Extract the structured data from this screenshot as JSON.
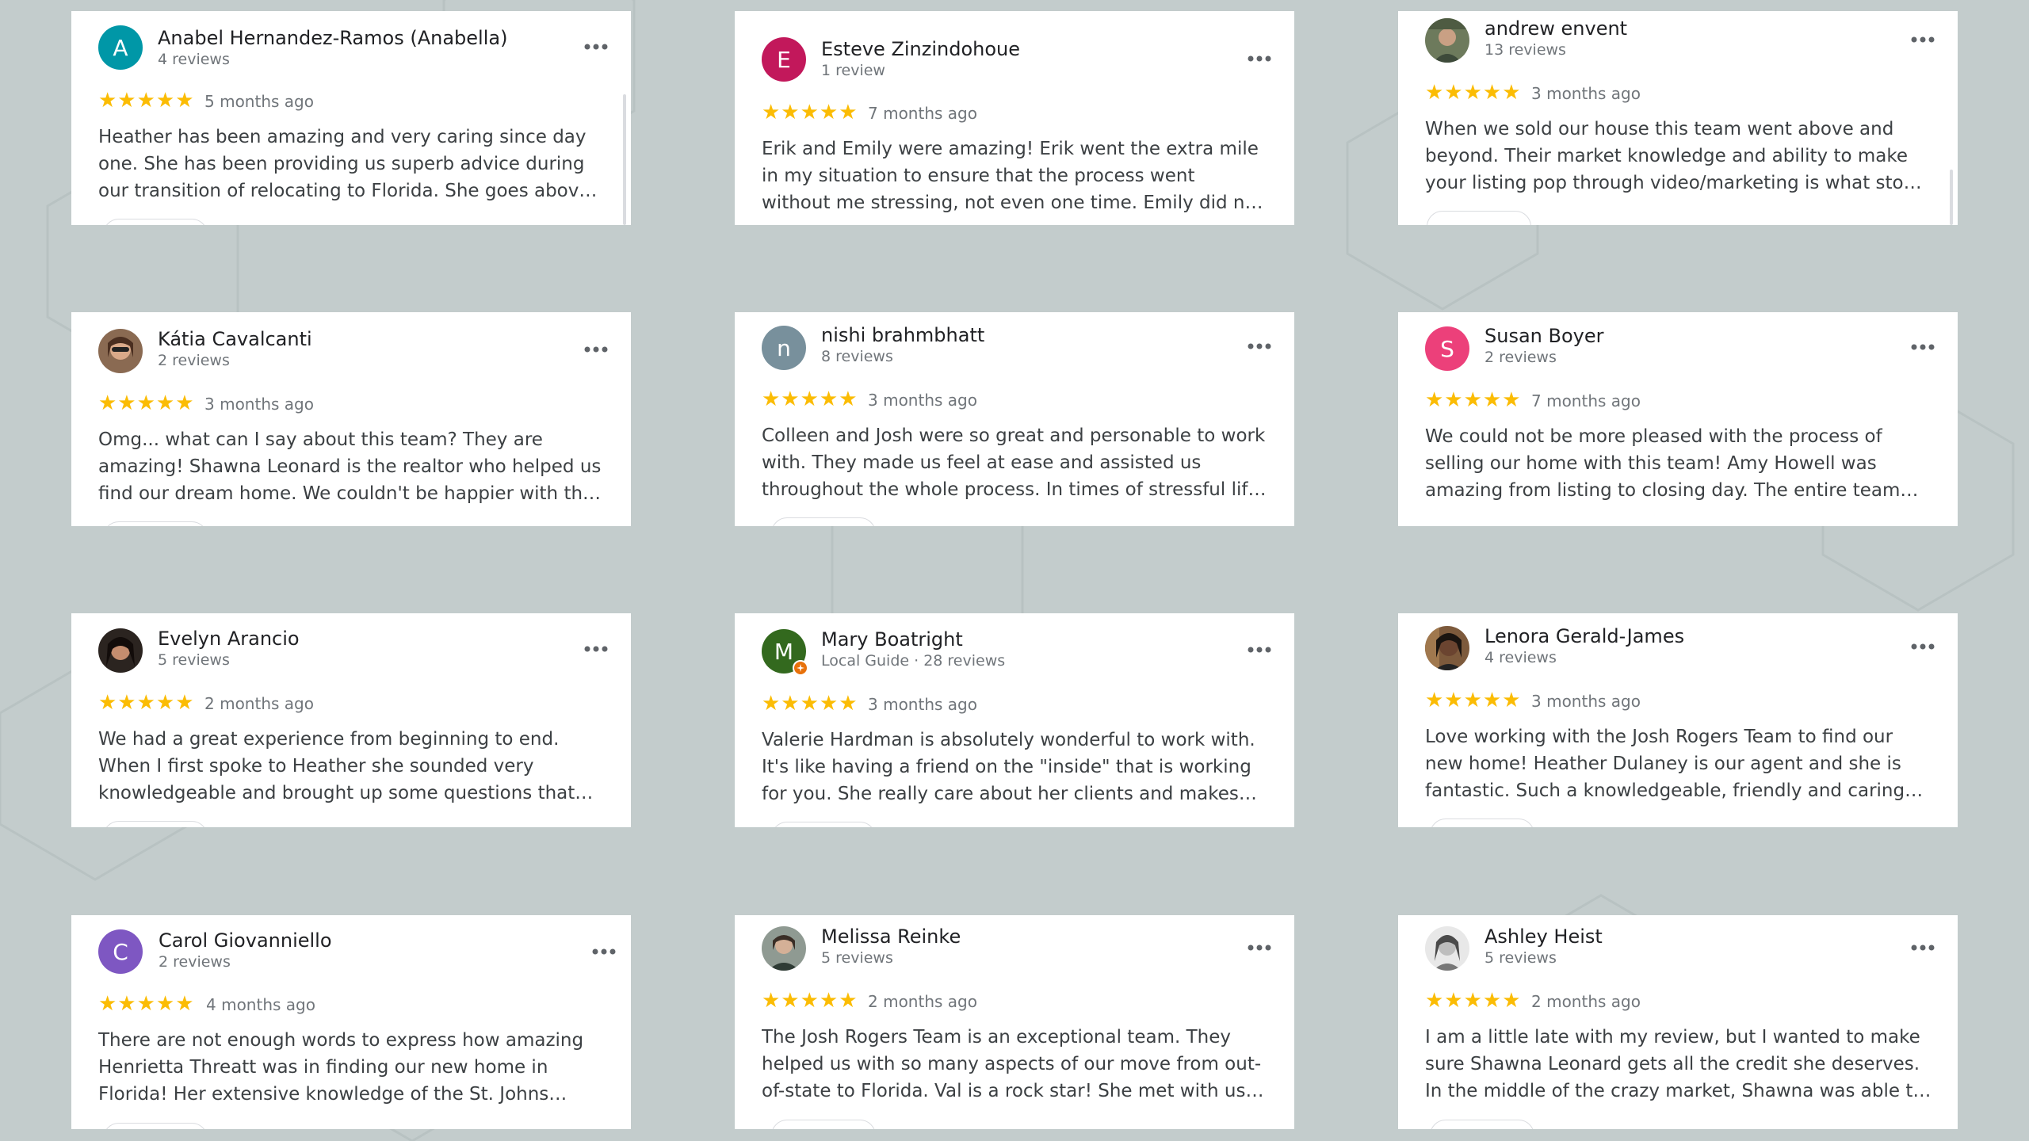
{
  "colors": {
    "background": "#c3cccc",
    "card": "#ffffff",
    "star": "#fbbc04",
    "name": "#202124",
    "meta": "#70757a"
  },
  "stars": "★★★★★",
  "reviews": [
    {
      "name": "Anabel Hernandez-Ramos (Anabella)",
      "meta": "4 reviews",
      "initial": "A",
      "avatar_color": "#0097a7",
      "time": "5 months ago",
      "text": "Heather has been amazing and very caring since day one. She has been providing us superb advice during our transition of relocating to Florida. She goes above and beyond"
    },
    {
      "name": "Esteve Zinzindohoue",
      "meta": "1 review",
      "initial": "E",
      "avatar_color": "#c2185b",
      "time": "7 months ago",
      "text": "Erik and Emily were amazing! Erik went the extra mile in my situation to ensure that the process went without me stressing, not even one time. Emily did not fail to let me know"
    },
    {
      "name": "andrew envent",
      "meta": "13 reviews",
      "initial": "",
      "avatar_color": "photo",
      "time": "3 months ago",
      "text": "When we sold our house this team went above and beyond. Their market knowledge and ability to make your listing pop through video/marketing is what stood out to us"
    },
    {
      "name": "Kátia Cavalcanti",
      "meta": "2 reviews",
      "initial": "",
      "avatar_color": "photo",
      "time": "3 months ago",
      "text": "Omg... what can I say about this team? They are amazing! Shawna Leonard is the realtor who helped us find our dream home. We couldn't be happier with the work she did"
    },
    {
      "name": "nishi brahmbhatt",
      "meta": "8 reviews",
      "initial": "n",
      "avatar_color": "#78909c",
      "time": "3 months ago",
      "text": "Colleen and Josh were so great and personable to work with.  They made us feel at ease and assisted us throughout the whole process.  In times of stressful life events"
    },
    {
      "name": "Susan Boyer",
      "meta": "2 reviews",
      "initial": "S",
      "avatar_color": "#ec407a",
      "time": "7 months ago",
      "text": "We could not be more pleased with the process of selling our home with this team! Amy Howell was amazing from listing to closing day. The entire team was responsive, professional"
    },
    {
      "name": "Evelyn Arancio",
      "meta": "5 reviews",
      "initial": "",
      "avatar_color": "photo",
      "time": "2 months ago",
      "text": "We had a great experience from beginning to end. When I first spoke to Heather she sounded very knowledgeable and brought up some questions that we did not even think of"
    },
    {
      "name": "Mary Boatright",
      "meta": "Local Guide · 28 reviews",
      "initial": "M",
      "avatar_color": "#33691e",
      "time": "3 months ago",
      "text": "Valerie Hardman is absolutely wonderful to work with. It's like having a friend on the \"inside\" that is working for you. She really care about her clients and makes every effort"
    },
    {
      "name": "Lenora Gerald-James",
      "meta": "4 reviews",
      "initial": "",
      "avatar_color": "photo",
      "time": "3 months ago",
      "text": "Love working with the Josh Rogers Team to find our new home! Heather Dulaney is our agent and she is fantastic. Such a knowledgeable, friendly and caring agent! We could not"
    },
    {
      "name": "Carol Giovanniello",
      "meta": "2 reviews",
      "initial": "C",
      "avatar_color": "#7e57c2",
      "time": "4 months ago",
      "text": "There are not enough words to express how amazing Henrietta Threatt was in finding our new home in Florida! Her extensive knowledge of the St. Johns County area is"
    },
    {
      "name": "Melissa Reinke",
      "meta": "5 reviews",
      "initial": "",
      "avatar_color": "photo",
      "time": "2 months ago",
      "text": "The Josh Rogers Team is an exceptional team.  They helped us with so many aspects of our move from out-of-state to Florida.  Val is a rock star!  She met with us multiple times"
    },
    {
      "name": "Ashley Heist",
      "meta": "5 reviews",
      "initial": "",
      "avatar_color": "photo",
      "time": "2 months ago",
      "text": "I am a little late with my review, but I wanted to make sure Shawna Leonard gets all the credit she deserves. In the middle of the crazy market, Shawna was able to find my"
    }
  ]
}
